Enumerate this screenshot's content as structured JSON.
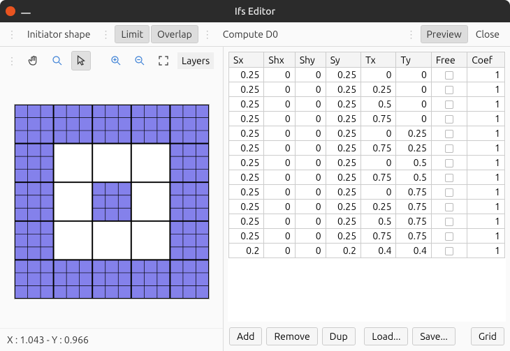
{
  "window": {
    "title": "Ifs Editor"
  },
  "top_toolbar": {
    "initiator": "Initiator shape",
    "limit": "Limit",
    "overlap": "Overlap",
    "compute": "Compute D0",
    "preview": "Preview",
    "close": "Close"
  },
  "icon_toolbar": {
    "layers": "Layers"
  },
  "status": {
    "text": "X : 1.043 - Y : 0.966"
  },
  "table": {
    "headers": [
      "Sx",
      "Shx",
      "Shy",
      "Sy",
      "Tx",
      "Ty",
      "Free",
      "Coef"
    ],
    "rows": [
      {
        "sx": "0.25",
        "shx": "0",
        "shy": "0",
        "sy": "0.25",
        "tx": "0",
        "ty": "0",
        "coef": "1"
      },
      {
        "sx": "0.25",
        "shx": "0",
        "shy": "0",
        "sy": "0.25",
        "tx": "0.25",
        "ty": "0",
        "coef": "1"
      },
      {
        "sx": "0.25",
        "shx": "0",
        "shy": "0",
        "sy": "0.25",
        "tx": "0.5",
        "ty": "0",
        "coef": "1"
      },
      {
        "sx": "0.25",
        "shx": "0",
        "shy": "0",
        "sy": "0.25",
        "tx": "0.75",
        "ty": "0",
        "coef": "1"
      },
      {
        "sx": "0.25",
        "shx": "0",
        "shy": "0",
        "sy": "0.25",
        "tx": "0",
        "ty": "0.25",
        "coef": "1"
      },
      {
        "sx": "0.25",
        "shx": "0",
        "shy": "0",
        "sy": "0.25",
        "tx": "0.75",
        "ty": "0.25",
        "coef": "1"
      },
      {
        "sx": "0.25",
        "shx": "0",
        "shy": "0",
        "sy": "0.25",
        "tx": "0",
        "ty": "0.5",
        "coef": "1"
      },
      {
        "sx": "0.25",
        "shx": "0",
        "shy": "0",
        "sy": "0.25",
        "tx": "0.75",
        "ty": "0.5",
        "coef": "1"
      },
      {
        "sx": "0.25",
        "shx": "0",
        "shy": "0",
        "sy": "0.25",
        "tx": "0",
        "ty": "0.75",
        "coef": "1"
      },
      {
        "sx": "0.25",
        "shx": "0",
        "shy": "0",
        "sy": "0.25",
        "tx": "0.25",
        "ty": "0.75",
        "coef": "1"
      },
      {
        "sx": "0.25",
        "shx": "0",
        "shy": "0",
        "sy": "0.25",
        "tx": "0.5",
        "ty": "0.75",
        "coef": "1"
      },
      {
        "sx": "0.25",
        "shx": "0",
        "shy": "0",
        "sy": "0.25",
        "tx": "0.75",
        "ty": "0.75",
        "coef": "1"
      },
      {
        "sx": "0.2",
        "shx": "0",
        "shy": "0",
        "sy": "0.2",
        "tx": "0.4",
        "ty": "0.4",
        "coef": "1"
      }
    ]
  },
  "bottom_buttons": {
    "add": "Add",
    "remove": "Remove",
    "dup": "Dup",
    "load": "Load...",
    "save": "Save...",
    "grid": "Grid"
  },
  "canvas": {
    "tile_color": "#8481eb",
    "grid_color": "#000000",
    "tiles_grid": 5,
    "tiles": [
      [
        1,
        1,
        1,
        1,
        1
      ],
      [
        1,
        0,
        0,
        0,
        1
      ],
      [
        1,
        0,
        1,
        0,
        1
      ],
      [
        1,
        0,
        0,
        0,
        1
      ],
      [
        1,
        1,
        1,
        1,
        1
      ]
    ],
    "inner_grid": 3
  }
}
